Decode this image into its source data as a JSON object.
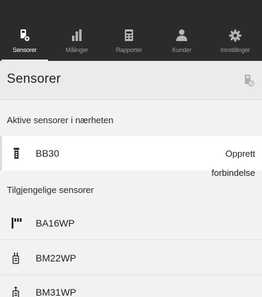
{
  "tabs": [
    {
      "label": "Sensorer",
      "icon": "sensor-device-icon",
      "active": true
    },
    {
      "label": "Målinger",
      "icon": "bar-chart-icon",
      "active": false
    },
    {
      "label": "Rapporter",
      "icon": "report-document-icon",
      "active": false
    },
    {
      "label": "Kunder",
      "icon": "customers-icon",
      "active": false
    },
    {
      "label": "Innstillinger",
      "icon": "gear-icon",
      "active": false
    }
  ],
  "header": {
    "title": "Sensorer",
    "icon": "sensor-disconnected-icon"
  },
  "nearby": {
    "title": "Aktive sensorer i nærheten",
    "items": [
      {
        "name": "BB30",
        "icon": "pressure-probe-icon",
        "action_label": "Opprett forbindelse"
      }
    ]
  },
  "available": {
    "title": "Tilgjengelige sensorer",
    "items": [
      {
        "name": "BA16WP",
        "icon": "comb-probe-icon"
      },
      {
        "name": "BM22WP",
        "icon": "tong-probe-icon"
      },
      {
        "name": "BM31WP",
        "icon": "hammer-probe-icon"
      }
    ]
  },
  "colors": {
    "tabbar_bg": "#2b2b2b",
    "page_bg": "#f2f2f2",
    "header_bg": "#ebebeb",
    "row_bg": "#ffffff"
  }
}
